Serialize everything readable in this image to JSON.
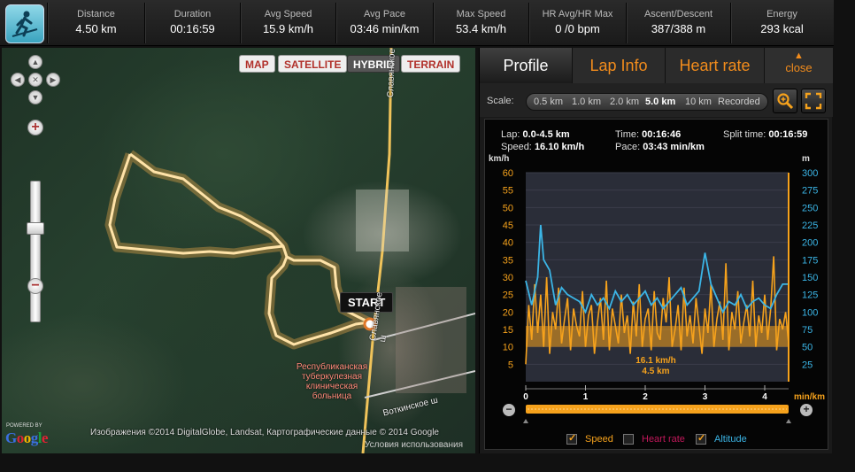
{
  "stats": [
    {
      "label": "Distance",
      "value": "4.50  km"
    },
    {
      "label": "Duration",
      "value": "00:16:59"
    },
    {
      "label": "Avg Speed",
      "value": "15.9 km/h"
    },
    {
      "label": "Avg Pace",
      "value": "03:46 min/km"
    },
    {
      "label": "Max Speed",
      "value": "53.4 km/h"
    },
    {
      "label": "HR Avg/HR Max",
      "value": "0 /0 bpm"
    },
    {
      "label": "Ascent/Descent",
      "value": "387/388 m"
    },
    {
      "label": "Energy",
      "value": "293  kcal"
    }
  ],
  "map": {
    "types": [
      "MAP",
      "SATELLITE",
      "HYBRID",
      "TERRAIN"
    ],
    "active_type": "HYBRID",
    "start_label": "START",
    "road_labels": [
      "Славянское ш",
      "Славянское ш",
      "Воткинское ш"
    ],
    "hospital_lines": [
      "Республиканская",
      "туберкулезная",
      "клиническая",
      "больница"
    ],
    "attribution": "Изображения ©2014 DigitalGlobe, Landsat, Картографические данные © 2014 Google",
    "terms": "Условия использования",
    "powered_by": "POWERED BY",
    "google": "Google"
  },
  "panel": {
    "tabs": [
      "Profile",
      "Lap Info",
      "Heart rate"
    ],
    "close": "close",
    "scale_label": "Scale:",
    "scale_options": [
      "0.5 km",
      "1.0 km",
      "2.0 km",
      "5.0 km",
      "10 km",
      "Recorded"
    ],
    "active_scale": "5.0 km",
    "info": {
      "lap_label": "Lap:",
      "lap_value": "0.0-4.5 km",
      "speed_label": "Speed:",
      "speed_value": "16.10 km/h",
      "time_label": "Time:",
      "time_value": "00:16:46",
      "pace_label": "Pace:",
      "pace_value": "03:43 min/km",
      "split_label": "Split time:",
      "split_value": "00:16:59"
    },
    "legend": [
      "Speed",
      "Heart rate",
      "Altitude"
    ]
  },
  "colors": {
    "speed": "#f6a21c",
    "altitude": "#3bb5e6",
    "heart_rate": "#c2185b",
    "accent": "#f28c1c"
  },
  "chart_data": {
    "type": "line",
    "xlabel": "min/km",
    "x_ticks": [
      "0",
      "1",
      "2",
      "3",
      "4"
    ],
    "xlim": [
      0,
      4.4
    ],
    "left_axis": {
      "unit": "km/h",
      "ticks": [
        5,
        10,
        15,
        20,
        25,
        30,
        35,
        40,
        45,
        50,
        55,
        60
      ],
      "ylim": [
        0,
        60
      ]
    },
    "right_axis": {
      "unit": "m",
      "ticks": [
        25,
        50,
        75,
        100,
        125,
        150,
        175,
        200,
        225,
        250,
        275,
        300
      ],
      "ylim": [
        0,
        300
      ]
    },
    "marker_label": [
      "16.1 km/h",
      "4.5 km"
    ],
    "average_band": {
      "from": 10,
      "to": 16
    },
    "series": [
      {
        "name": "Speed",
        "x": [
          0,
          0.05,
          0.1,
          0.15,
          0.2,
          0.25,
          0.3,
          0.35,
          0.4,
          0.45,
          0.5,
          0.55,
          0.6,
          0.65,
          0.7,
          0.75,
          0.8,
          0.85,
          0.9,
          0.95,
          1.0,
          1.05,
          1.1,
          1.15,
          1.2,
          1.25,
          1.3,
          1.35,
          1.4,
          1.45,
          1.5,
          1.55,
          1.6,
          1.65,
          1.7,
          1.75,
          1.8,
          1.85,
          1.9,
          1.95,
          2.0,
          2.05,
          2.1,
          2.15,
          2.2,
          2.25,
          2.3,
          2.35,
          2.4,
          2.45,
          2.5,
          2.55,
          2.6,
          2.65,
          2.7,
          2.75,
          2.8,
          2.85,
          2.9,
          2.95,
          3.0,
          3.05,
          3.1,
          3.15,
          3.2,
          3.25,
          3.3,
          3.35,
          3.4,
          3.45,
          3.5,
          3.55,
          3.6,
          3.65,
          3.7,
          3.75,
          3.8,
          3.85,
          3.9,
          3.95,
          4.0,
          4.05,
          4.1,
          4.15,
          4.2,
          4.25,
          4.3,
          4.35,
          4.4
        ],
        "values": [
          5,
          22,
          12,
          28,
          14,
          25,
          10,
          30,
          8,
          20,
          15,
          27,
          11,
          18,
          24,
          9,
          21,
          16,
          13,
          26,
          10,
          19,
          22,
          8,
          17,
          24,
          12,
          29,
          9,
          21,
          16,
          11,
          25,
          14,
          19,
          8,
          23,
          13,
          28,
          10,
          18,
          21,
          9,
          26,
          14,
          12,
          24,
          17,
          30,
          10,
          15,
          22,
          9,
          27,
          13,
          19,
          11,
          24,
          16,
          8,
          21,
          14,
          28,
          10,
          18,
          23,
          12,
          34,
          9,
          20,
          15,
          26,
          11,
          17,
          22,
          13,
          29,
          10,
          19,
          14,
          25,
          12,
          21,
          36,
          9,
          18,
          15,
          20,
          11
        ]
      },
      {
        "name": "Altitude",
        "x": [
          0,
          0.1,
          0.2,
          0.25,
          0.3,
          0.4,
          0.5,
          0.6,
          0.7,
          0.8,
          0.9,
          1.0,
          1.1,
          1.2,
          1.3,
          1.4,
          1.5,
          1.6,
          1.7,
          1.8,
          1.9,
          2.0,
          2.1,
          2.2,
          2.3,
          2.4,
          2.5,
          2.6,
          2.7,
          2.8,
          2.9,
          3.0,
          3.1,
          3.2,
          3.3,
          3.4,
          3.5,
          3.6,
          3.7,
          3.8,
          3.9,
          4.0,
          4.1,
          4.2,
          4.3,
          4.4
        ],
        "values": [
          145,
          110,
          150,
          225,
          175,
          160,
          110,
          135,
          125,
          120,
          115,
          100,
          125,
          110,
          120,
          105,
          130,
          115,
          125,
          110,
          120,
          130,
          110,
          120,
          105,
          115,
          125,
          135,
          110,
          120,
          130,
          185,
          140,
          120,
          100,
          115,
          110,
          125,
          105,
          115,
          120,
          110,
          105,
          125,
          140,
          140
        ]
      }
    ]
  }
}
